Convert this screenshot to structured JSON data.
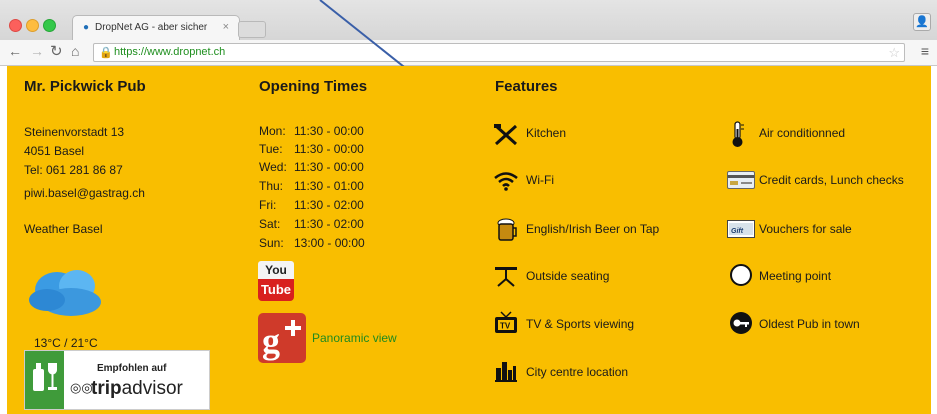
{
  "browser": {
    "tab_title": "DropNet AG - aber sicher",
    "url": "https://www.dropnet.ch"
  },
  "pub": {
    "heading": "Mr. Pickwick Pub",
    "street": "Steinenvorstadt 13",
    "city": "4051 Basel",
    "phone": "Tel: 061 281 86 87",
    "email": "piwi.basel@gastrag.ch",
    "weather_label": "Weather Basel",
    "temperature": "13°C / 21°C"
  },
  "opening": {
    "heading": "Opening Times",
    "rows": [
      {
        "day": "Mon:",
        "hours": "11:30 - 00:00"
      },
      {
        "day": "Tue:",
        "hours": "11:30 - 00:00"
      },
      {
        "day": "Wed:",
        "hours": "11:30 - 00:00"
      },
      {
        "day": "Thu:",
        "hours": "11:30 - 01:00"
      },
      {
        "day": "Fri:",
        "hours": "11:30 - 02:00"
      },
      {
        "day": "Sat:",
        "hours": "11:30 - 02:00"
      },
      {
        "day": "Sun:",
        "hours": "13:00 - 00:00"
      }
    ],
    "youtube_top": "You",
    "youtube_bottom": "Tube",
    "panoramic": "Panoramic view"
  },
  "tripadvisor": {
    "top": "Empfohlen auf",
    "brand_bold": "trip",
    "brand_rest": "advisor"
  },
  "features": {
    "heading": "Features",
    "left": [
      {
        "label": "Kitchen",
        "icon": "cutlery-icon"
      },
      {
        "label": "Wi-Fi",
        "icon": "wifi-icon"
      },
      {
        "label": "English/Irish Beer on Tap",
        "icon": "beer-tap-icon"
      },
      {
        "label": "Outside seating",
        "icon": "table-icon"
      },
      {
        "label": "TV & Sports viewing",
        "icon": "tv-icon"
      },
      {
        "label": "City centre location",
        "icon": "city-icon"
      }
    ],
    "right": [
      {
        "label": "Air conditionned",
        "icon": "thermometer-icon"
      },
      {
        "label": "Credit cards, Lunch checks",
        "icon": "credit-card-icon"
      },
      {
        "label": "Vouchers for sale",
        "icon": "voucher-icon"
      },
      {
        "label": "Meeting point",
        "icon": "circle-icon"
      },
      {
        "label": "Oldest Pub in town",
        "icon": "key-icon"
      }
    ]
  },
  "colors": {
    "page_background": "#f9be00",
    "link_green": "#1f8a1f",
    "tripadvisor_green": "#3f9b3a"
  }
}
